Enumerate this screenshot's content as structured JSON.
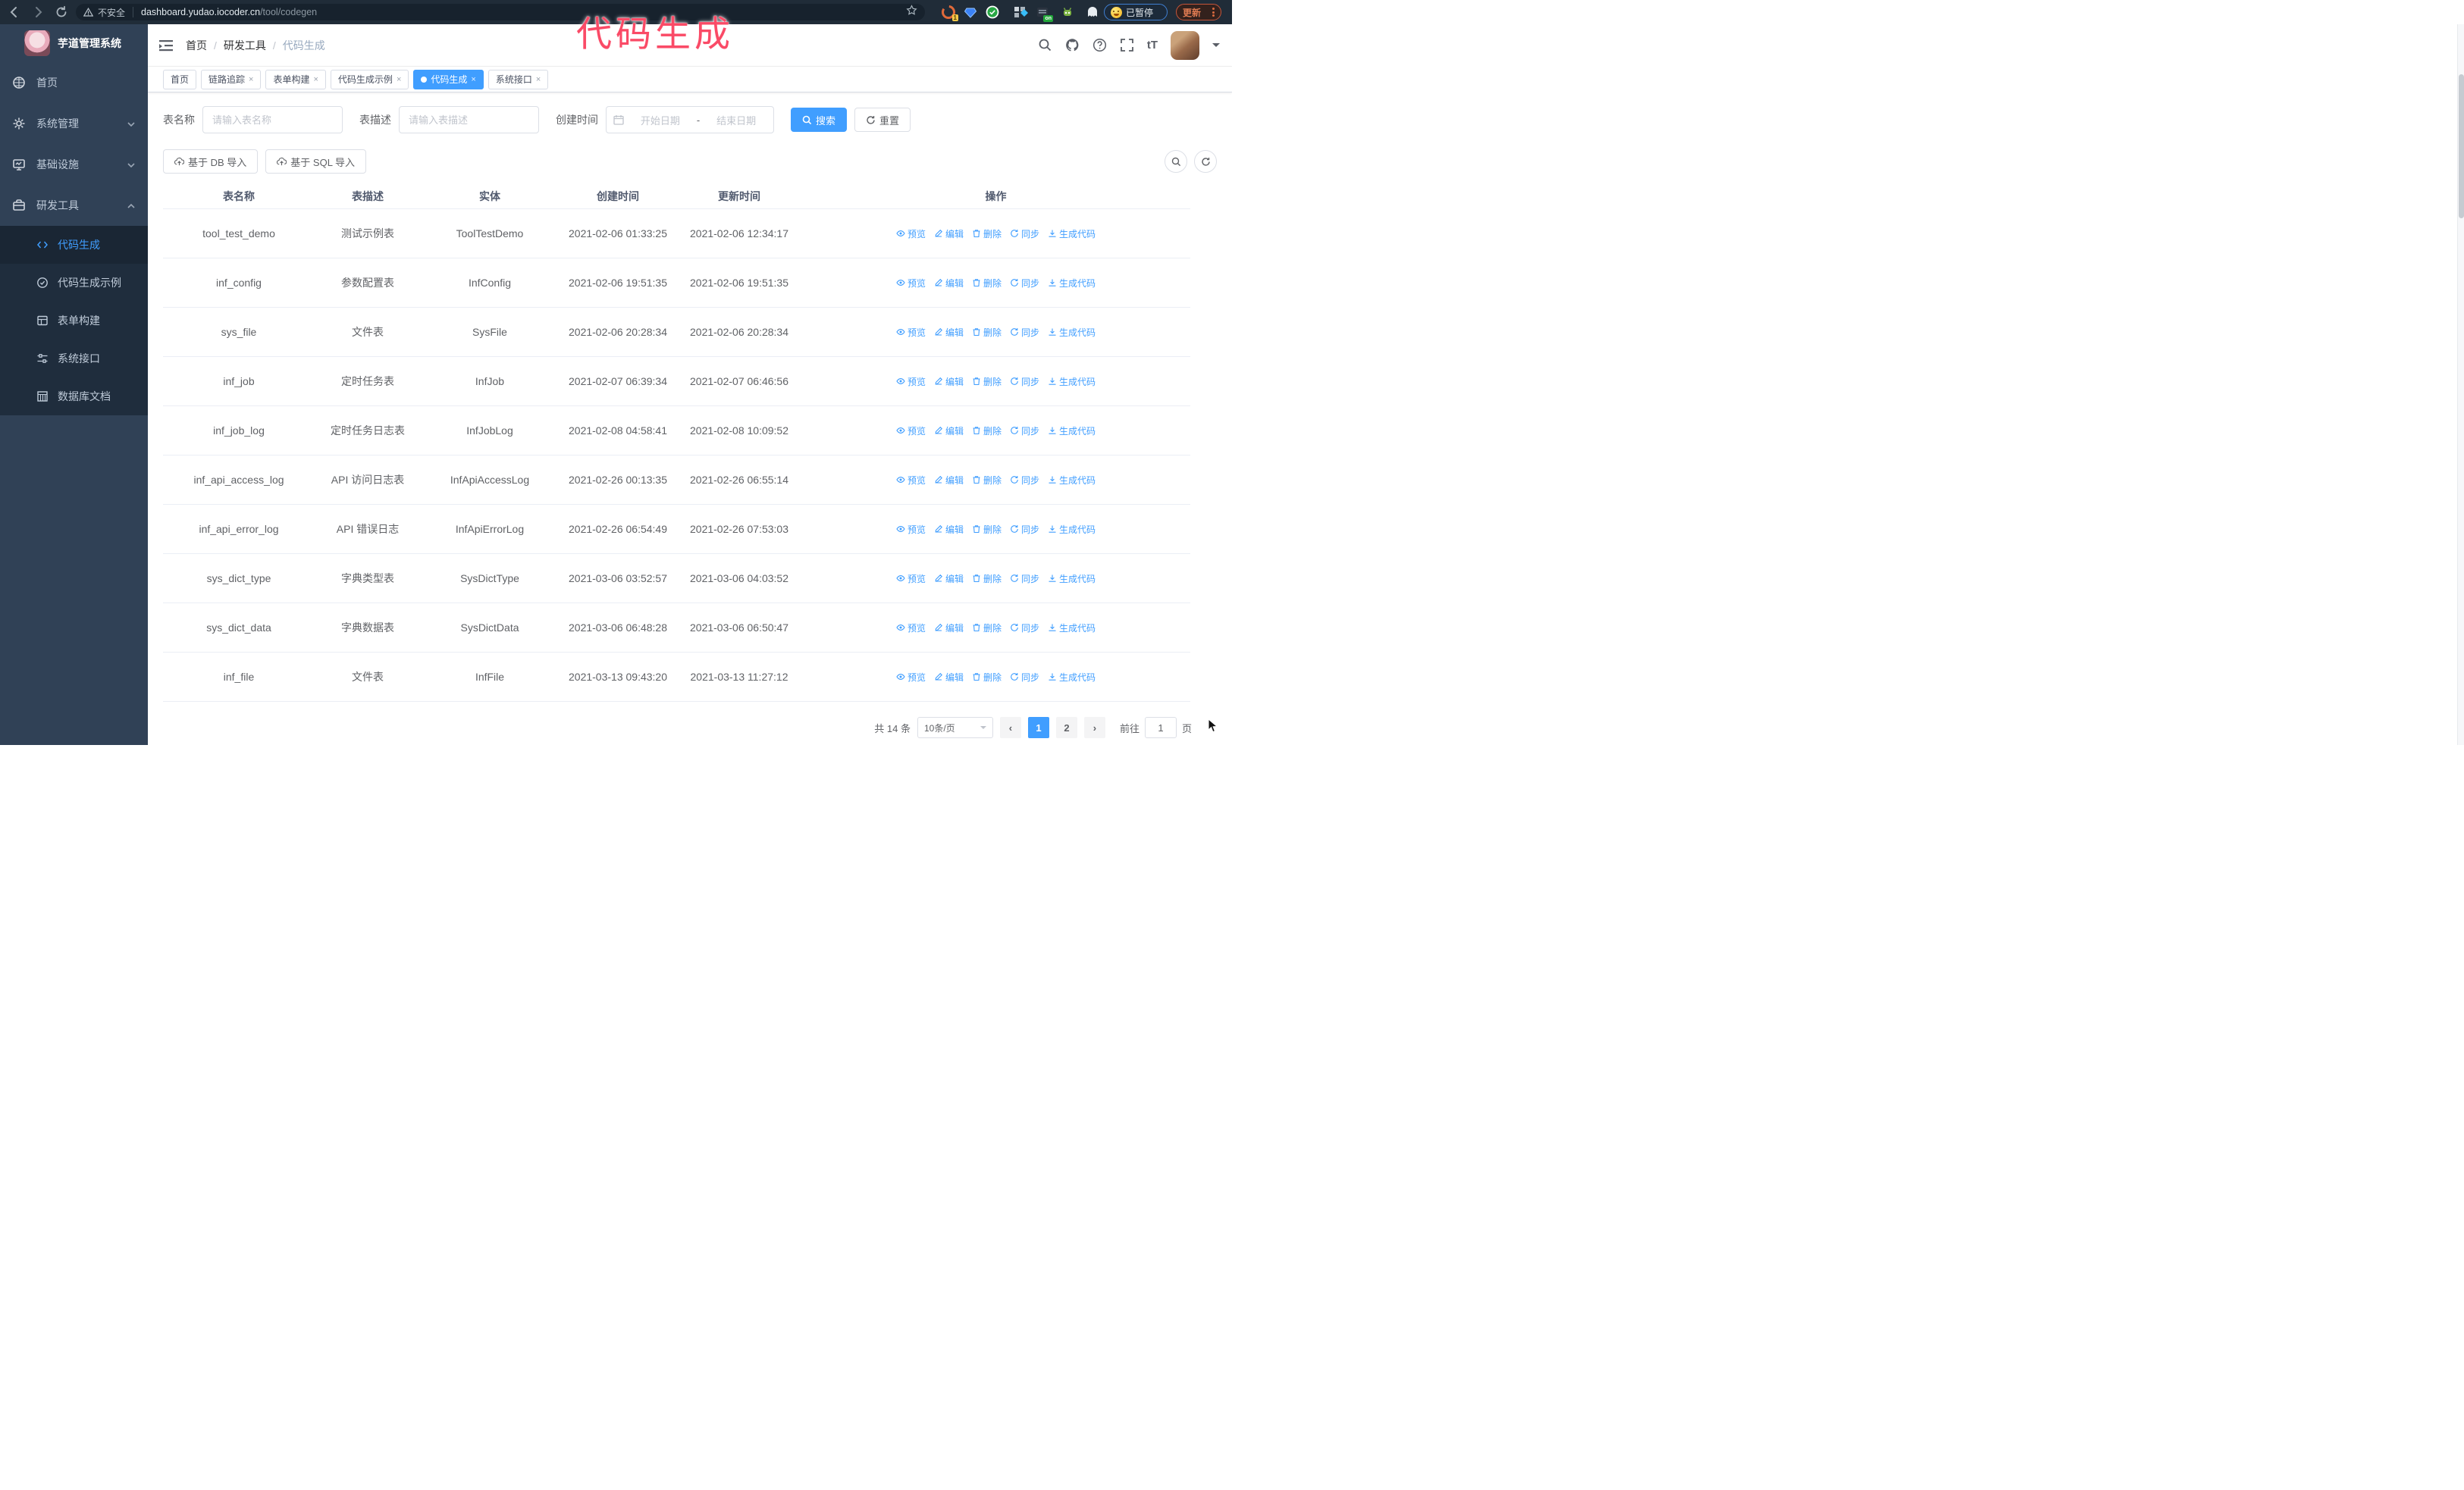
{
  "browser": {
    "security_label": "不安全",
    "url_domain": "dashboard.yudao.iocoder.cn",
    "url_path": "/tool/codegen",
    "extension_badge": "1",
    "extension_on_badge": "on",
    "profile_badge": "已暂停",
    "update_button": "更新"
  },
  "annotation": "代码生成",
  "sidebar": {
    "app_title": "芋道管理系统",
    "items": [
      {
        "label": "首页",
        "icon": "dashboard-icon"
      },
      {
        "label": "系统管理",
        "icon": "gear-icon",
        "state": "collapsed"
      },
      {
        "label": "基础设施",
        "icon": "monitor-icon",
        "state": "collapsed"
      },
      {
        "label": "研发工具",
        "icon": "toolbox-icon",
        "state": "expanded"
      }
    ],
    "subitems": [
      {
        "label": "代码生成",
        "icon": "code-icon",
        "active": true
      },
      {
        "label": "代码生成示例",
        "icon": "example-icon",
        "active": false
      },
      {
        "label": "表单构建",
        "icon": "form-icon",
        "active": false
      },
      {
        "label": "系统接口",
        "icon": "api-icon",
        "active": false
      },
      {
        "label": "数据库文档",
        "icon": "database-doc-icon",
        "active": false
      }
    ]
  },
  "navbar": {
    "breadcrumb": [
      "首页",
      "研发工具",
      "代码生成"
    ],
    "separator": "/"
  },
  "tabs": [
    {
      "label": "首页",
      "closable": false,
      "active": false
    },
    {
      "label": "链路追踪",
      "closable": true,
      "active": false
    },
    {
      "label": "表单构建",
      "closable": true,
      "active": false
    },
    {
      "label": "代码生成示例",
      "closable": true,
      "active": false
    },
    {
      "label": "代码生成",
      "closable": true,
      "active": true
    },
    {
      "label": "系统接口",
      "closable": true,
      "active": false
    }
  ],
  "filters": {
    "table_name_label": "表名称",
    "table_name_placeholder": "请输入表名称",
    "table_desc_label": "表描述",
    "table_desc_placeholder": "请输入表描述",
    "create_time_label": "创建时间",
    "date_start_placeholder": "开始日期",
    "date_separator": "-",
    "date_end_placeholder": "结束日期",
    "search_button": "搜索",
    "reset_button": "重置"
  },
  "toolbar": {
    "import_db_button": "基于 DB 导入",
    "import_sql_button": "基于 SQL 导入"
  },
  "table": {
    "columns": [
      "表名称",
      "表描述",
      "实体",
      "创建时间",
      "更新时间",
      "操作"
    ],
    "actions": [
      "预览",
      "编辑",
      "删除",
      "同步",
      "生成代码"
    ],
    "rows": [
      {
        "name": "tool_test_demo",
        "description": "测试示例表",
        "entity": "ToolTestDemo",
        "created": "2021-02-06 01:33:25",
        "updated": "2021-02-06 12:34:17"
      },
      {
        "name": "inf_config",
        "description": "参数配置表",
        "entity": "InfConfig",
        "created": "2021-02-06 19:51:35",
        "updated": "2021-02-06 19:51:35"
      },
      {
        "name": "sys_file",
        "description": "文件表",
        "entity": "SysFile",
        "created": "2021-02-06 20:28:34",
        "updated": "2021-02-06 20:28:34"
      },
      {
        "name": "inf_job",
        "description": "定时任务表",
        "entity": "InfJob",
        "created": "2021-02-07 06:39:34",
        "updated": "2021-02-07 06:46:56"
      },
      {
        "name": "inf_job_log",
        "description": "定时任务日志表",
        "entity": "InfJobLog",
        "created": "2021-02-08 04:58:41",
        "updated": "2021-02-08 10:09:52"
      },
      {
        "name": "inf_api_access_log",
        "description": "API 访问日志表",
        "entity": "InfApiAccessLog",
        "created": "2021-02-26 00:13:35",
        "updated": "2021-02-26 06:55:14"
      },
      {
        "name": "inf_api_error_log",
        "description": "API 错误日志",
        "entity": "InfApiErrorLog",
        "created": "2021-02-26 06:54:49",
        "updated": "2021-02-26 07:53:03"
      },
      {
        "name": "sys_dict_type",
        "description": "字典类型表",
        "entity": "SysDictType",
        "created": "2021-03-06 03:52:57",
        "updated": "2021-03-06 04:03:52"
      },
      {
        "name": "sys_dict_data",
        "description": "字典数据表",
        "entity": "SysDictData",
        "created": "2021-03-06 06:48:28",
        "updated": "2021-03-06 06:50:47"
      },
      {
        "name": "inf_file",
        "description": "文件表",
        "entity": "InfFile",
        "created": "2021-03-13 09:43:20",
        "updated": "2021-03-13 11:27:12"
      }
    ]
  },
  "pagination": {
    "total_label": "共 14 条",
    "page_size": "10条/页",
    "pages": [
      "1",
      "2"
    ],
    "active_page": "1",
    "goto_label": "前往",
    "goto_value": "1",
    "goto_suffix": "页"
  },
  "colors": {
    "primary": "#409EFF",
    "sidebar_bg": "#304156",
    "submenu_bg": "#1f2d3d",
    "annotation": "#fa4a66"
  }
}
